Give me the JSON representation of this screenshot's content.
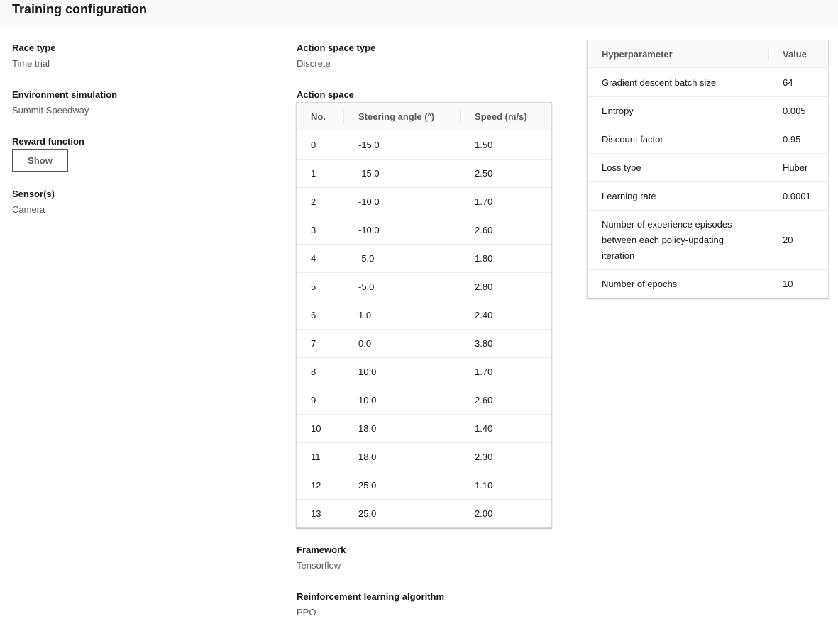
{
  "header": {
    "title": "Training configuration"
  },
  "left": {
    "race_type": {
      "label": "Race type",
      "value": "Time trial"
    },
    "environment": {
      "label": "Environment simulation",
      "value": "Summit Speedway"
    },
    "reward": {
      "label": "Reward function",
      "button": "Show"
    },
    "sensors": {
      "label": "Sensor(s)",
      "value": "Camera"
    }
  },
  "middle": {
    "action_space_type": {
      "label": "Action space type",
      "value": "Discrete"
    },
    "action_space": {
      "label": "Action space",
      "headers": [
        "No.",
        "Steering angle (°)",
        "Speed (m/s)"
      ],
      "rows": [
        [
          "0",
          "-15.0",
          "1.50"
        ],
        [
          "1",
          "-15.0",
          "2.50"
        ],
        [
          "2",
          "-10.0",
          "1.70"
        ],
        [
          "3",
          "-10.0",
          "2.60"
        ],
        [
          "4",
          "-5.0",
          "1.80"
        ],
        [
          "5",
          "-5.0",
          "2.80"
        ],
        [
          "6",
          "1.0",
          "2.40"
        ],
        [
          "7",
          "0.0",
          "3.80"
        ],
        [
          "8",
          "10.0",
          "1.70"
        ],
        [
          "9",
          "10.0",
          "2.60"
        ],
        [
          "10",
          "18.0",
          "1.40"
        ],
        [
          "11",
          "18.0",
          "2.30"
        ],
        [
          "12",
          "25.0",
          "1.10"
        ],
        [
          "13",
          "25.0",
          "2.00"
        ]
      ]
    },
    "framework": {
      "label": "Framework",
      "value": "Tensorflow"
    },
    "algorithm": {
      "label": "Reinforcement learning algorithm",
      "value": "PPO"
    }
  },
  "right": {
    "hyperparameters": {
      "headers": [
        "Hyperparameter",
        "Value"
      ],
      "rows": [
        {
          "name": "Gradient descent batch size",
          "value": "64"
        },
        {
          "name": "Entropy",
          "value": "0.005"
        },
        {
          "name": "Discount factor",
          "value": "0.95"
        },
        {
          "name": "Loss type",
          "value": "Huber"
        },
        {
          "name": "Learning rate",
          "value": "0.0001"
        },
        {
          "name": "Number of experience episodes between each policy-updating iteration",
          "value": "20"
        },
        {
          "name": "Number of epochs",
          "value": "10"
        }
      ]
    }
  }
}
